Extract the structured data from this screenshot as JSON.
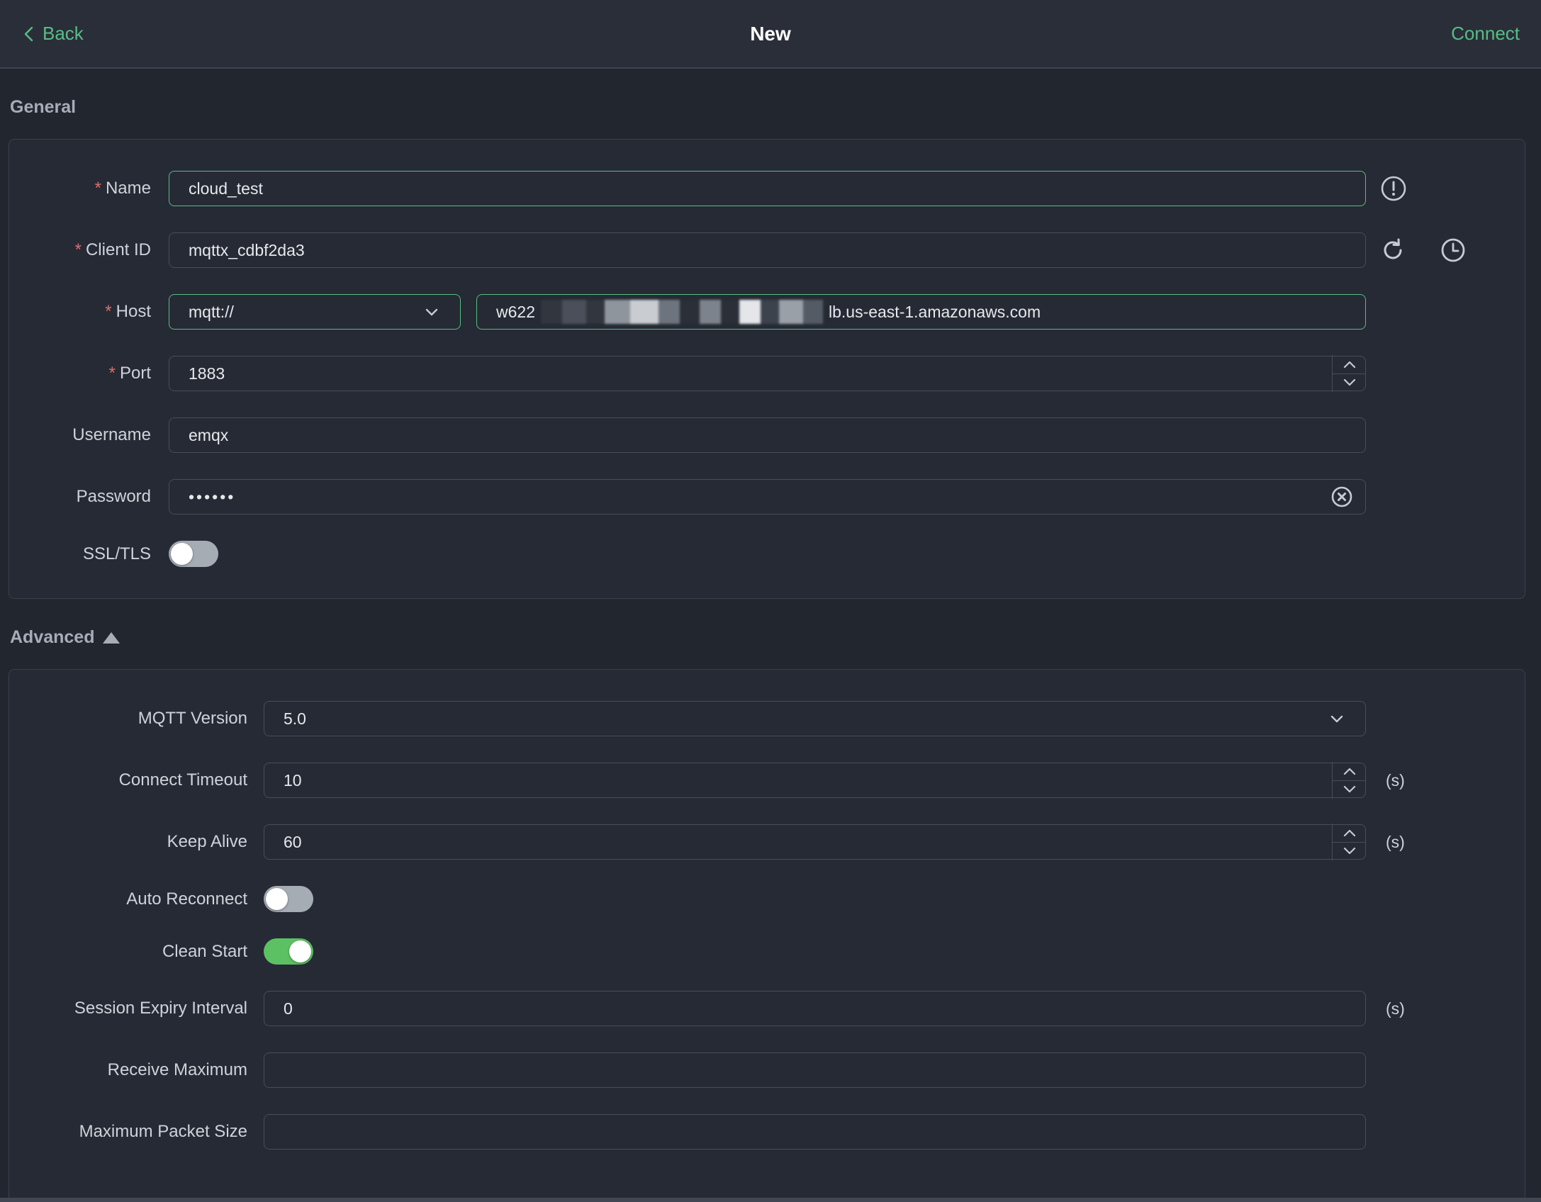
{
  "colors": {
    "accent_green": "#58bd86",
    "toggle_on_green": "#5cc163",
    "required_red": "#e06c6c",
    "page_bg": "#22262f",
    "card_bg": "#262a34"
  },
  "required_marker": "*",
  "topbar": {
    "back_label": "Back",
    "title": "New",
    "connect_label": "Connect"
  },
  "general": {
    "heading": "General",
    "name": {
      "label": "Name",
      "value": "cloud_test"
    },
    "client_id": {
      "label": "Client ID",
      "value": "mqttx_cdbf2da3"
    },
    "host": {
      "label": "Host",
      "protocol_selected": "mqtt://",
      "value_prefix": "w622",
      "value_redacted": "[redacted]",
      "value_suffix": "lb.us-east-1.amazonaws.com"
    },
    "port": {
      "label": "Port",
      "value": "1883"
    },
    "username": {
      "label": "Username",
      "value": "emqx"
    },
    "password": {
      "label": "Password",
      "value": "••••••"
    },
    "ssl": {
      "label": "SSL/TLS",
      "state": "off"
    }
  },
  "advanced": {
    "heading": "Advanced",
    "mqtt_version": {
      "label": "MQTT Version",
      "value": "5.0"
    },
    "connect_timeout": {
      "label": "Connect Timeout",
      "value": "10",
      "unit": "(s)"
    },
    "keep_alive": {
      "label": "Keep Alive",
      "value": "60",
      "unit": "(s)"
    },
    "auto_reconnect": {
      "label": "Auto Reconnect",
      "state": "off"
    },
    "clean_start": {
      "label": "Clean Start",
      "state": "on"
    },
    "session_expiry": {
      "label": "Session Expiry Interval",
      "value": "0",
      "unit": "(s)"
    },
    "receive_maximum": {
      "label": "Receive Maximum",
      "value": ""
    },
    "max_packet_size": {
      "label": "Maximum Packet Size",
      "value": ""
    }
  },
  "icons": {
    "back_chevron": "chevron-left",
    "name_info": "circle-exclamation",
    "client_id_refresh": "refresh",
    "client_id_history": "clock-history",
    "password_clear": "circle-x",
    "select_chevron": "chevron-down"
  }
}
